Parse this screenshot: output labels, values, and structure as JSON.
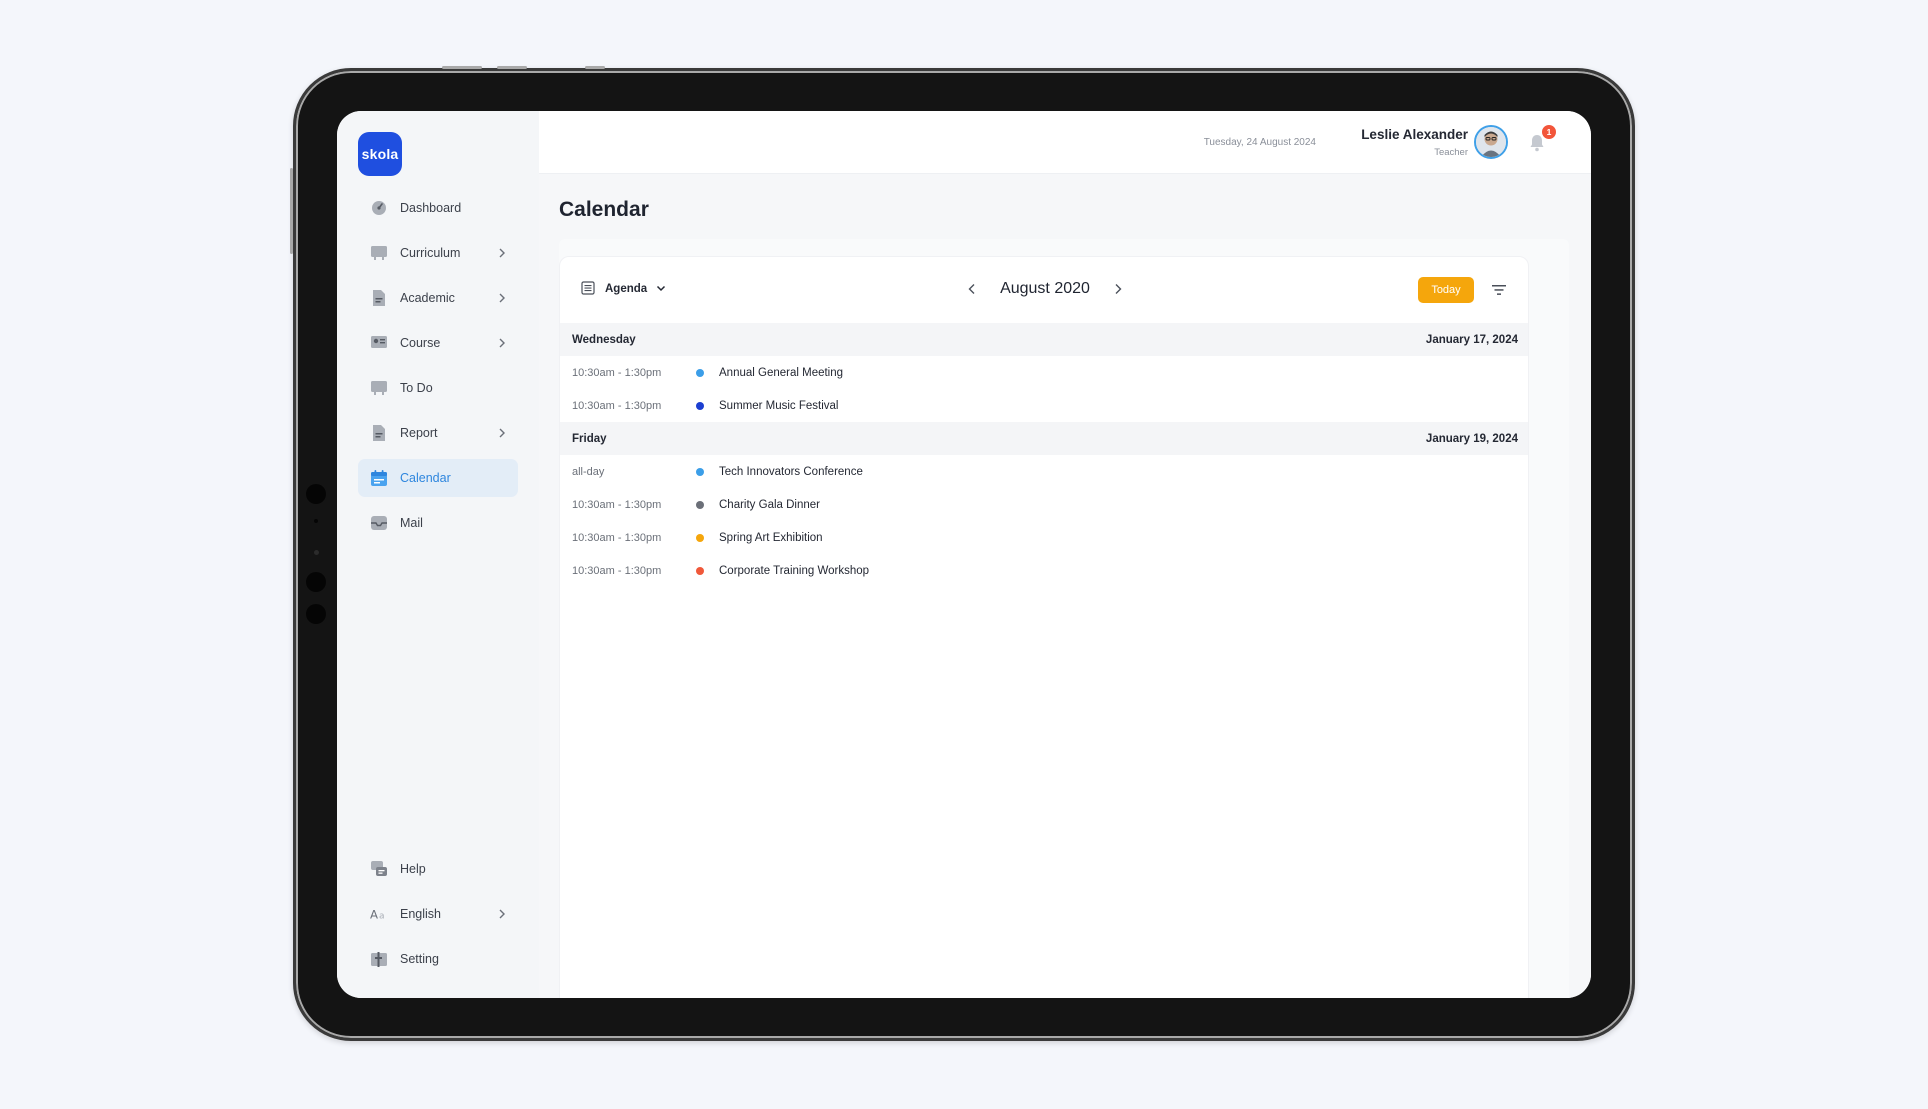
{
  "app": {
    "logo_text": "skola"
  },
  "sidebar": {
    "items": [
      {
        "label": "Dashboard",
        "icon": "dashboard-gauge-icon",
        "has_chevron": false
      },
      {
        "label": "Curriculum",
        "icon": "curriculum-board-icon",
        "has_chevron": true
      },
      {
        "label": "Academic",
        "icon": "academic-document-icon",
        "has_chevron": true
      },
      {
        "label": "Course",
        "icon": "course-card-icon",
        "has_chevron": true
      },
      {
        "label": "To Do",
        "icon": "todo-board-icon",
        "has_chevron": false
      },
      {
        "label": "Report",
        "icon": "report-document-icon",
        "has_chevron": true
      },
      {
        "label": "Calendar",
        "icon": "calendar-icon",
        "has_chevron": false,
        "active": true
      },
      {
        "label": "Mail",
        "icon": "mail-inbox-icon",
        "has_chevron": false
      }
    ],
    "bottom_items": [
      {
        "label": "Help",
        "icon": "help-chat-icon",
        "has_chevron": false
      },
      {
        "label": "English",
        "icon": "language-aa-icon",
        "has_chevron": true
      },
      {
        "label": "Setting",
        "icon": "setting-icon",
        "has_chevron": false
      }
    ]
  },
  "header": {
    "date": "Tuesday, 24 August 2024",
    "user_name": "Leslie Alexander",
    "user_role": "Teacher",
    "notification_count": "1"
  },
  "page": {
    "title": "Calendar"
  },
  "calendar": {
    "view_label": "Agenda",
    "month_label": "August 2020",
    "today_label": "Today",
    "days": [
      {
        "weekday": "Wednesday",
        "date": "January 17, 2024",
        "events": [
          {
            "time": "10:30am - 1:30pm",
            "title": "Annual General Meeting",
            "color": "#3b9ee8"
          },
          {
            "time": "10:30am - 1:30pm",
            "title": "Summer Music Festival",
            "color": "#1c3fd1"
          }
        ]
      },
      {
        "weekday": "Friday",
        "date": "January 19, 2024",
        "events": [
          {
            "time": "all-day",
            "title": "Tech Innovators Conference",
            "color": "#3b9ee8"
          },
          {
            "time": "10:30am - 1:30pm",
            "title": "Charity Gala Dinner",
            "color": "#6b6f78"
          },
          {
            "time": "10:30am - 1:30pm",
            "title": "Spring Art Exhibition",
            "color": "#f5a60c"
          },
          {
            "time": "10:30am - 1:30pm",
            "title": "Corporate Training Workshop",
            "color": "#f0583a"
          }
        ]
      }
    ]
  },
  "colors": {
    "brand": "#1f4fe0",
    "accent": "#2e86de",
    "today_button": "#f5a60c",
    "badge": "#f2553a"
  }
}
